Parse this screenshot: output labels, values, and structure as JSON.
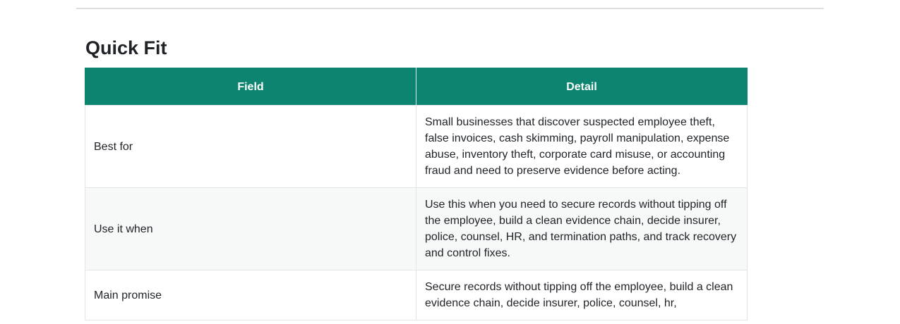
{
  "section": {
    "title": "Quick Fit"
  },
  "table": {
    "headers": [
      "Field",
      "Detail"
    ],
    "rows": [
      {
        "field": "Best for",
        "detail": "Small businesses that discover suspected employee theft, false invoices, cash skimming, payroll manipulation, expense abuse, inventory theft, corporate card misuse, or accounting fraud and need to preserve evidence before acting."
      },
      {
        "field": "Use it when",
        "detail": "Use this when you need to secure records without tipping off the employee, build a clean evidence chain, decide insurer, police, counsel, HR, and termination paths, and track recovery and control fixes."
      },
      {
        "field": "Main promise",
        "detail": "Secure records without tipping off the employee, build a clean evidence chain, decide insurer, police, counsel, hr,"
      }
    ]
  },
  "colors": {
    "header_bg": "#0d8470",
    "header_text": "#ffffff",
    "alt_row_bg": "#f7f9f9",
    "border": "#e3e6e8"
  }
}
